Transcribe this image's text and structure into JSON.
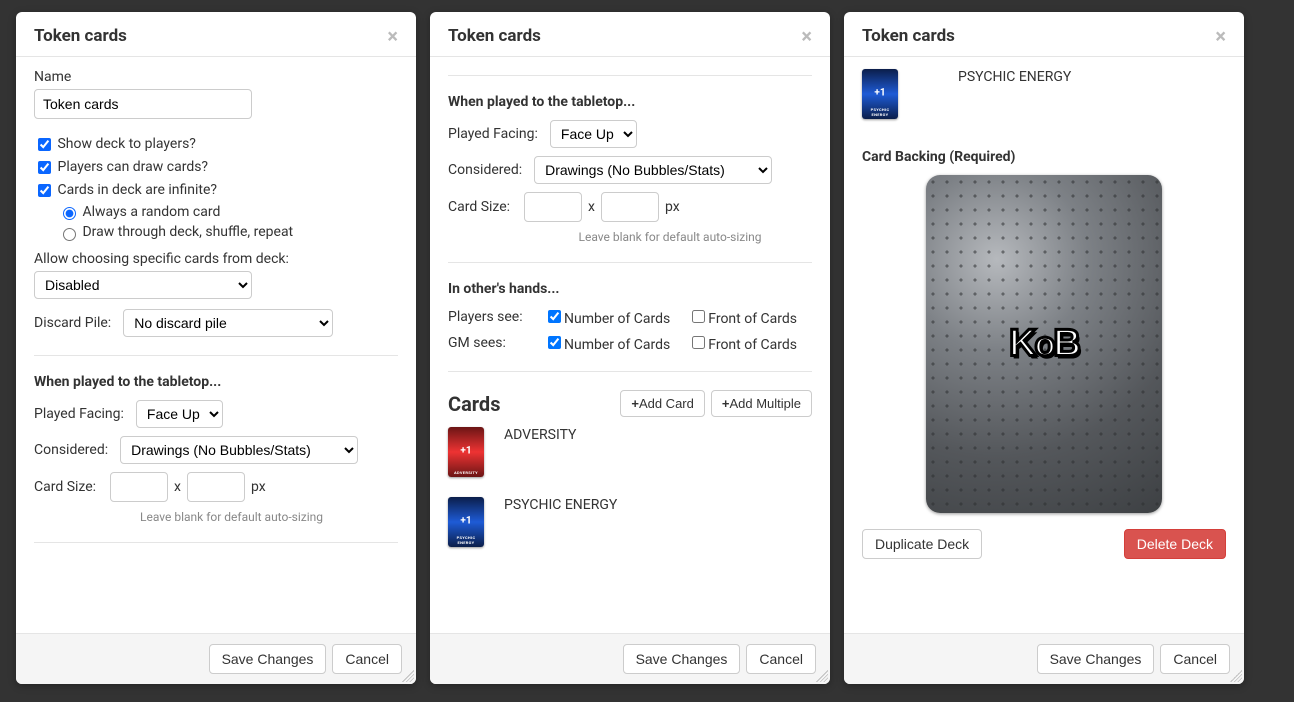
{
  "modal_title": "Token cards",
  "footer": {
    "save": "Save Changes",
    "cancel": "Cancel"
  },
  "panel1": {
    "name_label": "Name",
    "name_value": "Token cards",
    "show_deck": "Show deck to players?",
    "players_draw": "Players can draw cards?",
    "infinite": "Cards in deck are infinite?",
    "radio_random": "Always a random card",
    "radio_shuffle": "Draw through deck, shuffle, repeat",
    "allow_choose_label": "Allow choosing specific cards from deck:",
    "allow_choose_value": "Disabled",
    "discard_label": "Discard Pile:",
    "discard_value": "No discard pile",
    "played_section": "When played to the tabletop...",
    "played_facing_label": "Played Facing:",
    "played_facing_value": "Face Up",
    "considered_label": "Considered:",
    "considered_value": "Drawings (No Bubbles/Stats)",
    "card_size_label": "Card Size:",
    "card_size_x": "x",
    "card_size_px": "px",
    "size_hint": "Leave blank for default auto-sizing"
  },
  "panel2": {
    "played_section": "When played to the tabletop...",
    "played_facing_label": "Played Facing:",
    "played_facing_value": "Face Up",
    "considered_label": "Considered:",
    "considered_value": "Drawings (No Bubbles/Stats)",
    "card_size_label": "Card Size:",
    "card_size_x": "x",
    "card_size_px": "px",
    "size_hint": "Leave blank for default auto-sizing",
    "others_hands": "In other's hands...",
    "players_see": "Players see:",
    "gm_sees": "GM sees:",
    "num_cards": "Number of Cards",
    "front_cards": "Front of Cards",
    "cards_heading": "Cards",
    "add_card": "Add Card",
    "add_multiple": "Add Multiple",
    "card_list": [
      {
        "name": "ADVERSITY",
        "color": "red"
      },
      {
        "name": "PSYCHIC ENERGY",
        "color": "blue"
      }
    ]
  },
  "panel3": {
    "top_card_name": "PSYCHIC ENERGY",
    "backing_label": "Card Backing (Required)",
    "logo": "KoB",
    "duplicate": "Duplicate Deck",
    "delete": "Delete Deck"
  }
}
